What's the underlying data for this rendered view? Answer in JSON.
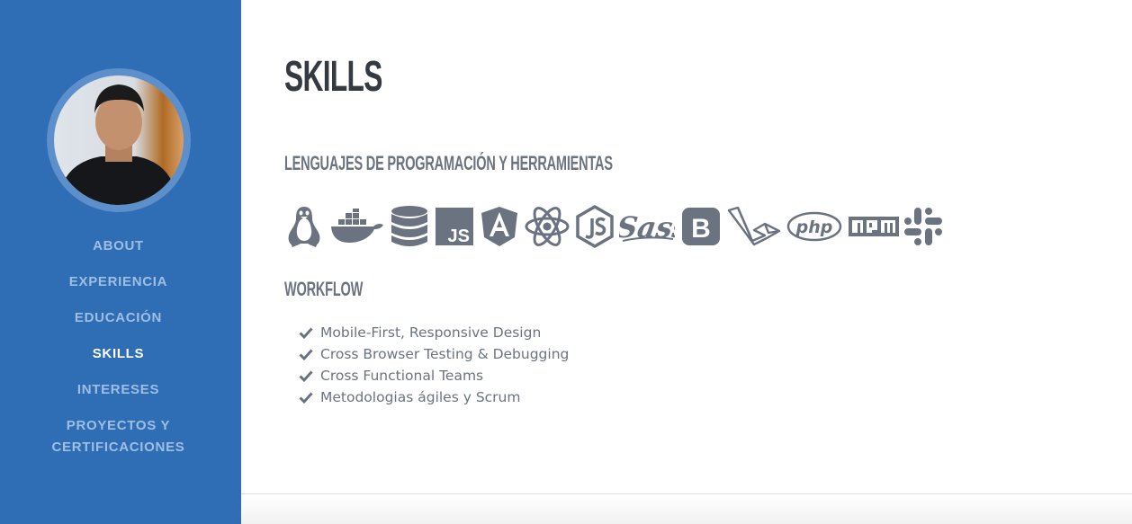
{
  "colors": {
    "sidebar_bg": "#2f6db5",
    "nav_text": "#9ebfe4",
    "nav_active": "#ffffff",
    "heading": "#343a40",
    "text_muted": "#6c7380"
  },
  "nav": {
    "items": [
      {
        "label": "About",
        "active": false
      },
      {
        "label": "Experiencia",
        "active": false
      },
      {
        "label": "Educación",
        "active": false
      },
      {
        "label": "Skills",
        "active": true
      },
      {
        "label": "Intereses",
        "active": false
      },
      {
        "label": "Proyectos y",
        "active": false
      },
      {
        "label": "Certificaciones",
        "active": false
      }
    ]
  },
  "page": {
    "title": "SKILLS",
    "languages_heading": "LENGUAJES DE PROGRAMACIÓN Y HERRAMIENTAS",
    "tech_icons": [
      "linux-icon",
      "docker-icon",
      "database-icon",
      "js-icon",
      "angular-icon",
      "react-icon",
      "nodejs-icon",
      "sass-icon",
      "bootstrap-icon",
      "laravel-icon",
      "php-icon",
      "npm-icon",
      "slack-icon"
    ],
    "workflow_heading": "WORKFLOW",
    "workflow_items": [
      "Mobile-First, Responsive Design",
      "Cross Browser Testing & Debugging",
      "Cross Functional Teams",
      "Metodologias ágiles y Scrum"
    ]
  }
}
